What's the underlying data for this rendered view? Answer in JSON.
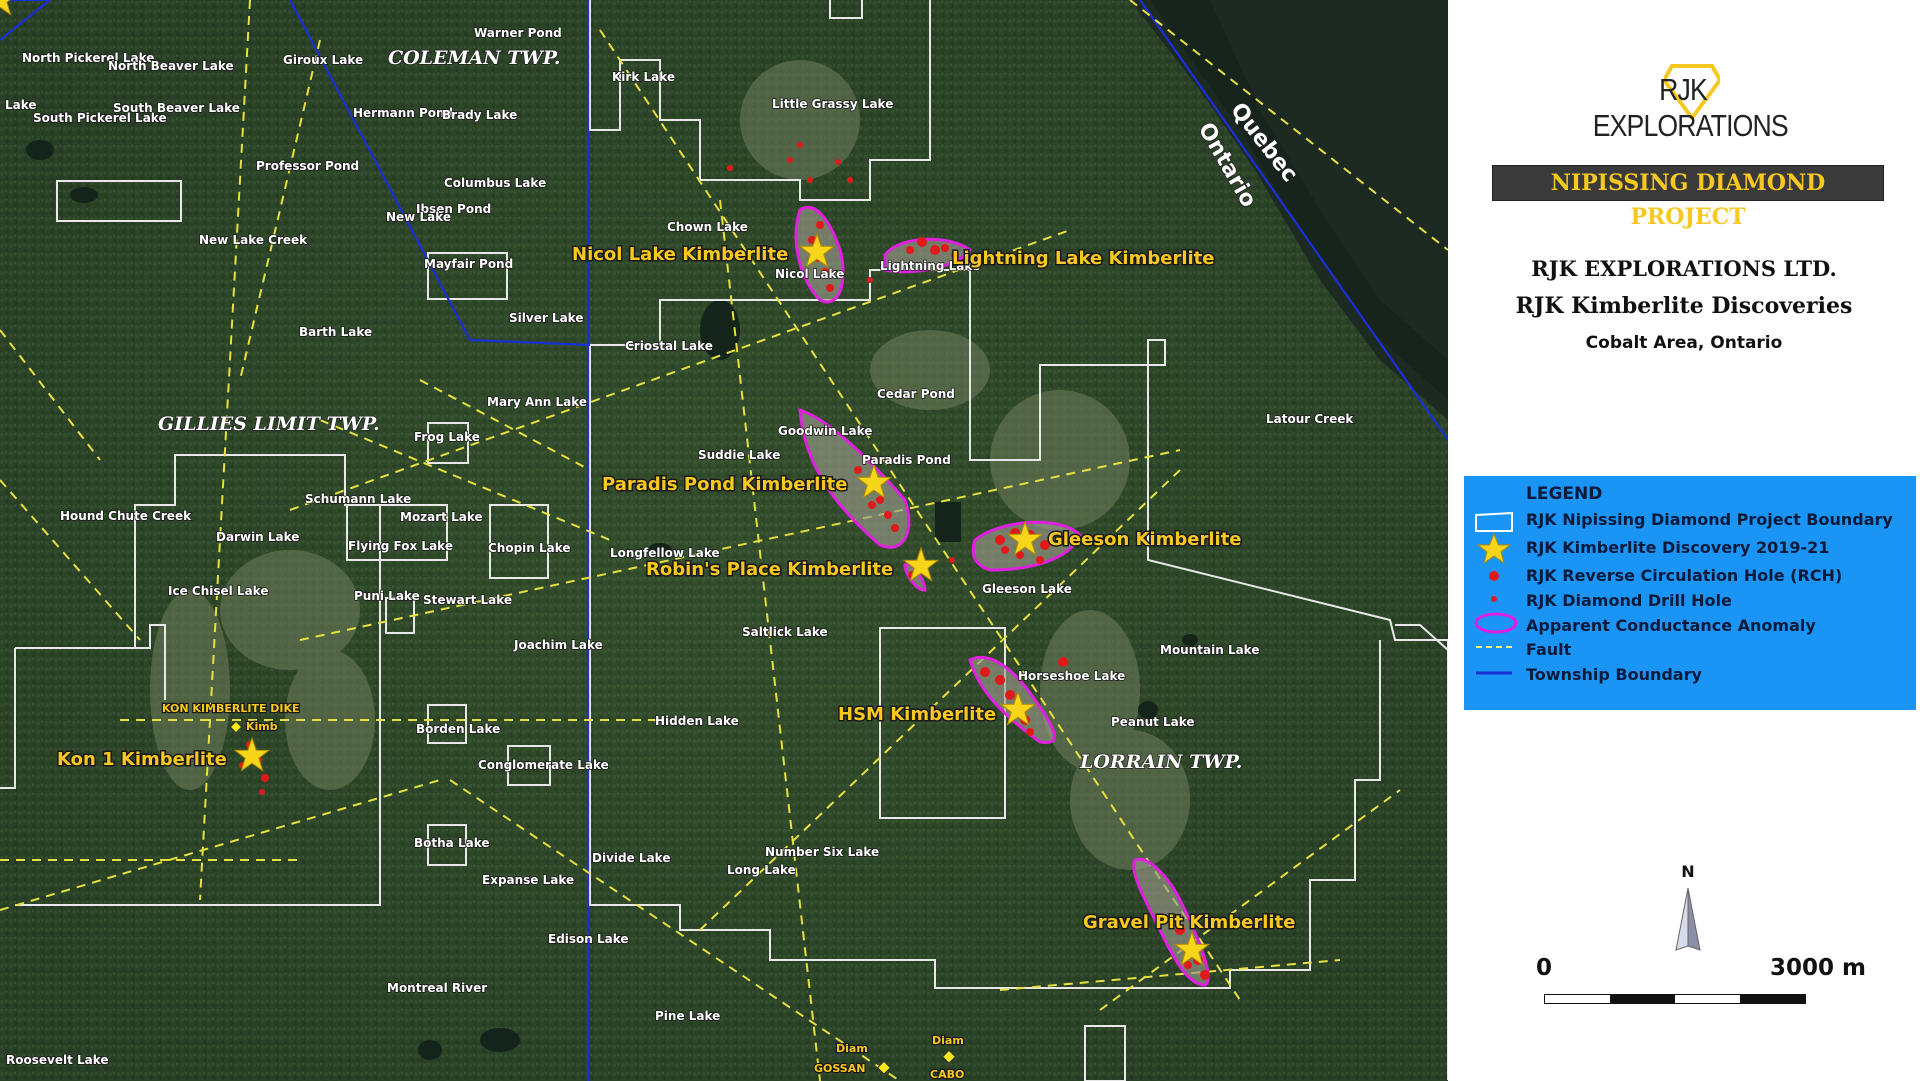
{
  "map": {
    "townships": [
      "COLEMAN TWP.",
      "GILLIES LIMIT TWP.",
      "LORRAIN TWP."
    ],
    "provinces": [
      "Quebec",
      "Ontario"
    ],
    "lakes": [
      "Warner Pond",
      "North Pickerel Lake",
      "North Beaver Lake",
      "Giroux Lake",
      "Lake",
      "South Pickerel Lake",
      "South Beaver Lake",
      "Hermann Pond",
      "Brady Lake",
      "Professor Pond",
      "Columbus Lake",
      "Ibsen Pond",
      "New Lake",
      "New Lake Creek",
      "Mayfair Pond",
      "Silver Lake",
      "Barth Lake",
      "Mary Ann Lake",
      "Frog Lake",
      "Schumann Lake",
      "Hound Chute Creek",
      "Mozart Lake",
      "Darwin Lake",
      "Flying Fox Lake",
      "Chopin Lake",
      "Ice Chisel Lake",
      "Puni Lake",
      "Stewart Lake",
      "Joachim Lake",
      "Borden Lake",
      "Conglomerate Lake",
      "Botha Lake",
      "Expanse Lake",
      "Edison Lake",
      "Montreal River",
      "Pine Lake",
      "Roosevelt Lake",
      "Kirk Lake",
      "Little Grassy Lake",
      "Chown Lake",
      "Nicol Lake",
      "Lightning Lake",
      "Criostal Lake",
      "Cedar Pond",
      "Goodwin Lake",
      "Suddie Lake",
      "Paradis Pond",
      "Longfellow Lake",
      "Saltlick Lake",
      "Hidden Lake",
      "Number Six Lake",
      "Divide Lake",
      "Long Lake",
      "Gleeson Lake",
      "Horseshoe Lake",
      "Peanut Lake",
      "Mountain Lake",
      "Latour Creek"
    ],
    "kimberlites": [
      "Nicol Lake Kimberlite",
      "Lightning Lake Kimberlite",
      "Paradis Pond Kimberlite",
      "Robin's Place Kimberlite",
      "Gleeson Kimberlite",
      "HSM Kimberlite",
      "Gravel Pit Kimberlite",
      "Kon 1 Kimberlite"
    ],
    "small_labels": [
      "KON KIMBERLITE DIKE",
      "Kimb",
      "Diam",
      "GOSSAN",
      "Diam",
      "CABO"
    ]
  },
  "brand": {
    "logo_text": "RJK EXPLORATIONS",
    "project_title": "NIPISSING DIAMOND PROJECT",
    "company": "RJK EXPLORATIONS LTD.",
    "subtitle": "RJK Kimberlite Discoveries",
    "location": "Cobalt Area, Ontario",
    "project_title_color": "#f7c820"
  },
  "legend": {
    "title": "LEGEND",
    "background": "#1a94f5",
    "items": [
      {
        "label": "RJK Nipissing Diamond Project Boundary",
        "icon": "boundary-box-icon"
      },
      {
        "label": "RJK Kimberlite Discovery 2019-21",
        "icon": "star-icon"
      },
      {
        "label": "RJK Reverse Circulation Hole (RCH)",
        "icon": "red-dot-icon"
      },
      {
        "label": "RJK Diamond Drill Hole",
        "icon": "small-red-dot-icon"
      },
      {
        "label": "Apparent Conductance Anomaly",
        "icon": "magenta-ellipse-icon"
      },
      {
        "label": "Fault",
        "icon": "dashed-line-icon"
      },
      {
        "label": "Township Boundary",
        "icon": "blue-line-icon"
      }
    ]
  },
  "north_arrow": "N",
  "scale": {
    "start": "0",
    "end": "3000 m"
  }
}
